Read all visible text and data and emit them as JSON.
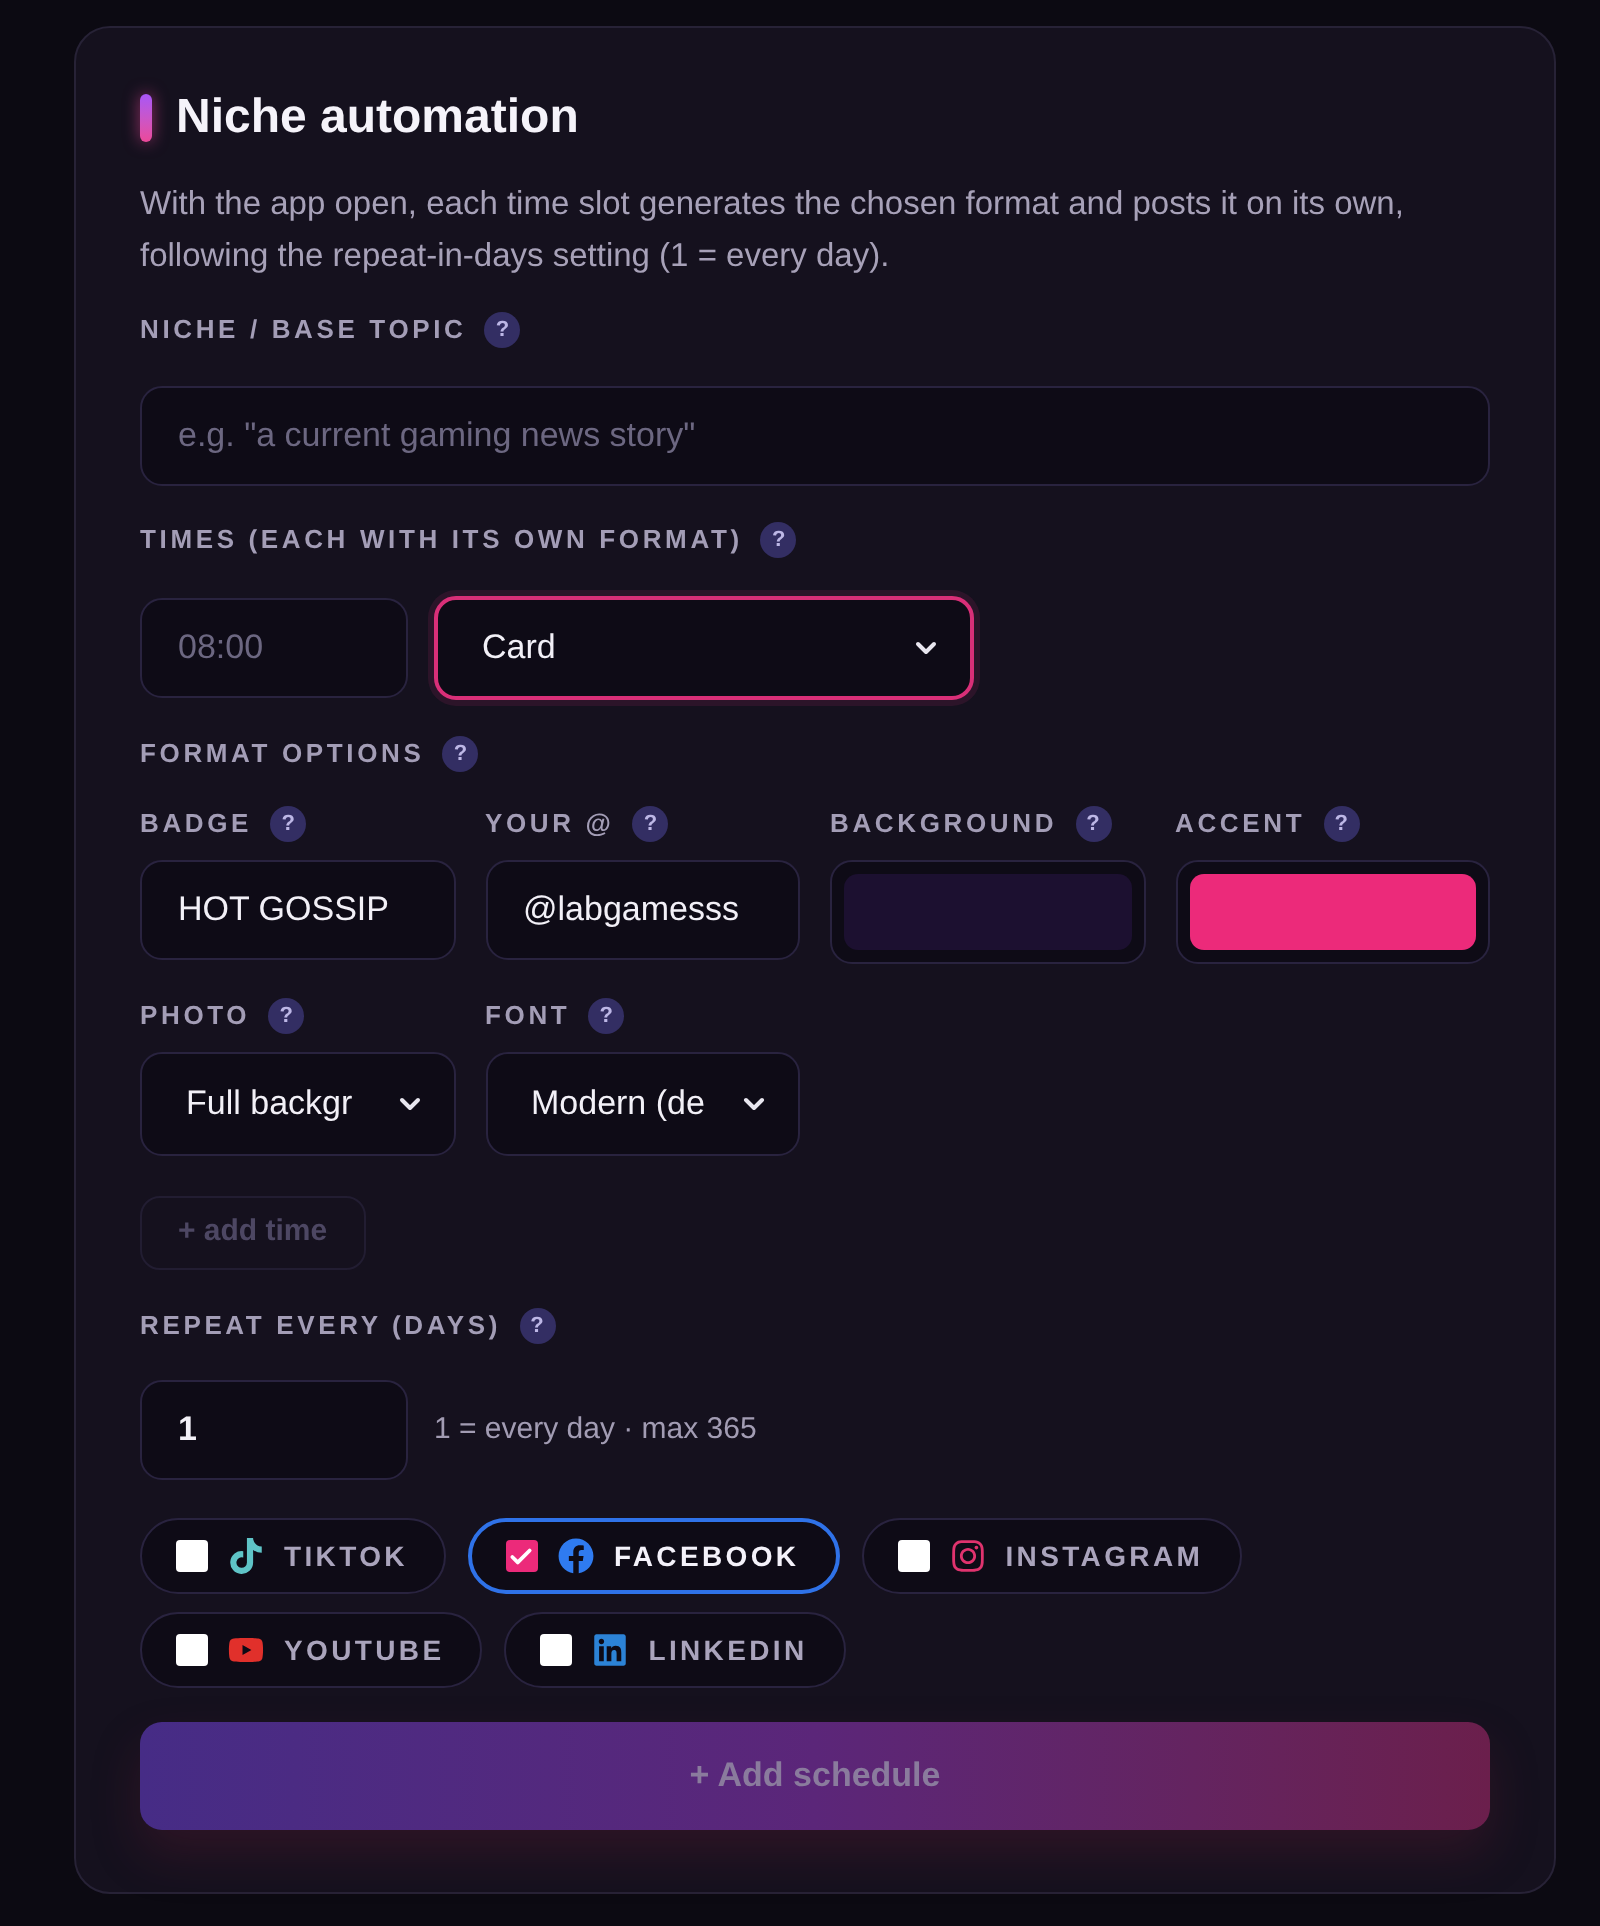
{
  "section": {
    "title": "Niche automation",
    "description": "With the app open, each time slot generates the chosen format and posts it on its own, following the repeat-in-days setting (1 = every day)."
  },
  "topic": {
    "label": "NICHE / BASE TOPIC",
    "help": "?",
    "placeholder": "e.g. \"a current gaming news story\""
  },
  "times": {
    "label": "TIMES (EACH WITH ITS OWN FORMAT)",
    "help": "?",
    "slots": [
      {
        "time": {
          "placeholder": "08:00"
        },
        "format": {
          "value": "Card",
          "focused": true
        }
      }
    ]
  },
  "format_options": {
    "label": "FORMAT OPTIONS",
    "help": "?",
    "fields": [
      {
        "kind": "text",
        "label": "BADGE",
        "help": "?",
        "value": "HOT GOSSIP"
      },
      {
        "kind": "text",
        "label": "YOUR @",
        "help": "?",
        "value": "@labgamesss"
      },
      {
        "kind": "color",
        "label": "BACKGROUND",
        "help": "?",
        "color": "#1c1030"
      },
      {
        "kind": "color",
        "label": "ACCENT",
        "help": "?",
        "color": "#ec2a7a"
      },
      {
        "kind": "select",
        "label": "PHOTO",
        "help": "?",
        "value": "Full backgr"
      },
      {
        "kind": "select",
        "label": "FONT",
        "help": "?",
        "value": "Modern (de"
      }
    ]
  },
  "add_time": {
    "label": "+ add time",
    "disabled": true
  },
  "repeat": {
    "label": "REPEAT EVERY (DAYS)",
    "help": "?",
    "value": "1",
    "hint": "1 = every day · max 365"
  },
  "platforms": [
    {
      "name": "TIKTOK",
      "checked": false
    },
    {
      "name": "FACEBOOK",
      "checked": true
    },
    {
      "name": "INSTAGRAM",
      "checked": false
    },
    {
      "name": "YOUTUBE",
      "checked": false
    },
    {
      "name": "LINKEDIN",
      "checked": false
    }
  ],
  "submit": {
    "label": "+ Add schedule",
    "disabled": true
  }
}
